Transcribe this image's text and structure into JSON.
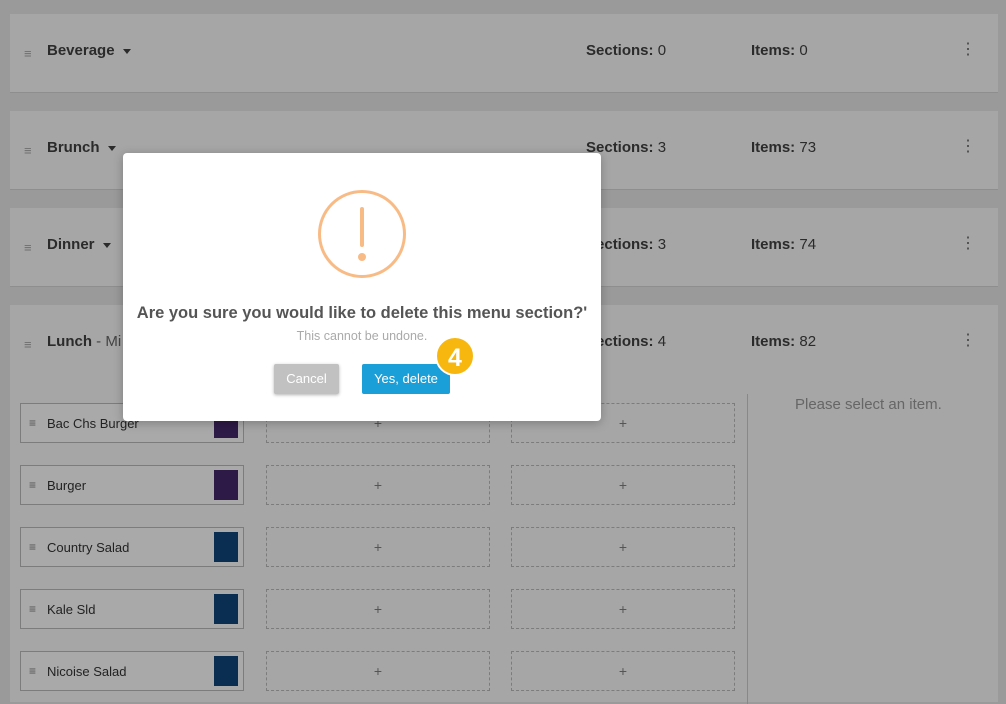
{
  "menus": [
    {
      "name": "Beverage",
      "subtitle": "",
      "sections_label": "Sections:",
      "sections": "0",
      "items_label": "Items:",
      "items": "0"
    },
    {
      "name": "Brunch",
      "subtitle": "",
      "sections_label": "Sections:",
      "sections": "3",
      "items_label": "Items:",
      "items": "73"
    },
    {
      "name": "Dinner",
      "subtitle": "",
      "sections_label": "Sections:",
      "sections": "3",
      "items_label": "Items:",
      "items": "74"
    },
    {
      "name": "Lunch",
      "subtitle": " - Mi",
      "sections_label": "Sections:",
      "sections": "4",
      "items_label": "Items:",
      "items": "82"
    }
  ],
  "section_items": [
    {
      "label": "Bac Chs Burger",
      "color": "#2e1a47"
    },
    {
      "label": "Burger",
      "color": "#2e1a47"
    },
    {
      "label": "Country Salad",
      "color": "#0a2d52"
    },
    {
      "label": "Kale Sld",
      "color": "#0a2d52"
    },
    {
      "label": "Nicoise Salad",
      "color": "#0a2d52"
    }
  ],
  "add_symbol": "+",
  "empty_note": "Please select an item.",
  "dialog": {
    "title": "Are you sure you would like to delete this menu section?'",
    "text": "This cannot be undone.",
    "cancel_label": "Cancel",
    "confirm_label": "Yes, delete",
    "accent_color": "#f8bb86",
    "confirm_color": "#1a9fd9"
  },
  "step_badge": "4"
}
